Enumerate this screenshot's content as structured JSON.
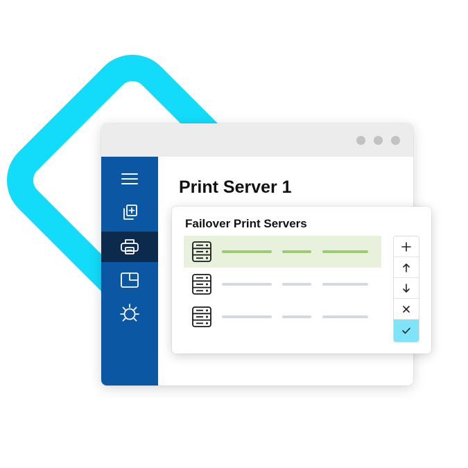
{
  "window": {
    "page_title": "Print Server 1",
    "titlebar_dots": 3
  },
  "sidebar": {
    "items": [
      {
        "icon": "menu-icon",
        "active": false
      },
      {
        "icon": "add-copy-icon",
        "active": false
      },
      {
        "icon": "printer-icon",
        "active": true
      },
      {
        "icon": "window-corner-icon",
        "active": false
      },
      {
        "icon": "bug-icon",
        "active": false
      }
    ]
  },
  "failover_panel": {
    "title": "Failover Print Servers",
    "rows": [
      {
        "icon": "server-icon",
        "selected": true
      },
      {
        "icon": "server-icon",
        "selected": false
      },
      {
        "icon": "server-icon",
        "selected": false
      }
    ],
    "buttons": [
      {
        "icon": "plus-icon",
        "label": "+"
      },
      {
        "icon": "arrow-up-icon",
        "label": "↑"
      },
      {
        "icon": "arrow-down-icon",
        "label": "↓"
      },
      {
        "icon": "close-icon",
        "label": "×"
      },
      {
        "icon": "check-icon",
        "label": "✓"
      }
    ]
  },
  "colors": {
    "accent_cyan": "#12dcfa",
    "sidebar_blue": "#0b57a4",
    "sidebar_active": "#0c2a4b",
    "row_selected_bg": "#e8f1dc",
    "bar_green": "#9ccb74",
    "bar_gray": "#d3d9df",
    "confirm_bg": "#7fe4f8"
  }
}
